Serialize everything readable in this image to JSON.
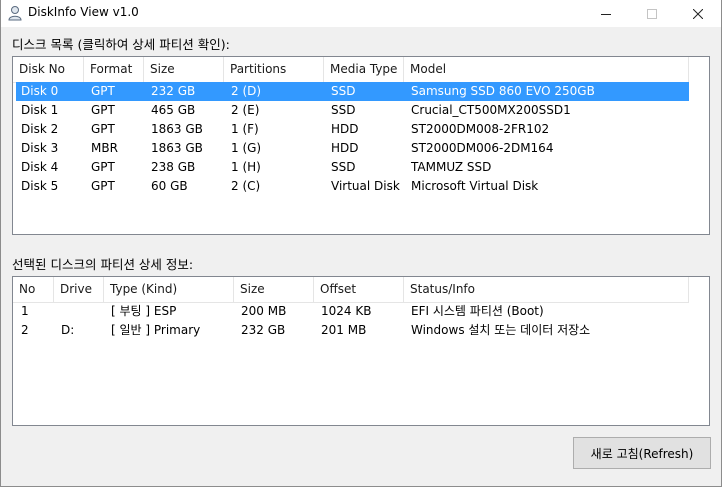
{
  "window": {
    "title": "DiskInfo View v1.0"
  },
  "titlebar_buttons": {
    "minimize": "—",
    "maximize": "☐",
    "close": "✕"
  },
  "disk_section": {
    "label": "디스크 목록 (클릭하여 상세 파티션 확인):"
  },
  "disk_list": {
    "columns": [
      "Disk No",
      "Format",
      "Size",
      "Partitions",
      "Media Type",
      "Model"
    ],
    "rows": [
      [
        "Disk 0",
        "GPT",
        "232 GB",
        "2 (D)",
        "SSD",
        "Samsung SSD 860 EVO 250GB"
      ],
      [
        "Disk 1",
        "GPT",
        "465 GB",
        "2 (E)",
        "SSD",
        "Crucial_CT500MX200SSD1"
      ],
      [
        "Disk 2",
        "GPT",
        "1863 GB",
        "1 (F)",
        "HDD",
        "ST2000DM008-2FR102"
      ],
      [
        "Disk 3",
        "MBR",
        "1863 GB",
        "1 (G)",
        "HDD",
        "ST2000DM006-2DM164"
      ],
      [
        "Disk 4",
        "GPT",
        "238 GB",
        "1 (H)",
        "SSD",
        "TAMMUZ SSD"
      ],
      [
        "Disk 5",
        "GPT",
        "60 GB",
        "2 (C)",
        "Virtual Disk",
        "Microsoft Virtual Disk"
      ]
    ],
    "selected_row": "Disk 0"
  },
  "partition_section": {
    "label": "선택된 디스크의 파티션 상세 정보:"
  },
  "partition_list": {
    "columns": [
      "No",
      "Drive",
      "Type (Kind)",
      "Size",
      "Offset",
      "Status/Info"
    ],
    "rows": [
      [
        "1",
        "",
        "[ 부팅 ] ESP",
        "200 MB",
        "1024 KB",
        "EFI 시스템 파티션 (Boot)"
      ],
      [
        "2",
        "D:",
        "[ 일반 ] Primary",
        "232 GB",
        "201 MB",
        "Windows 설치 또는 데이터 저장소"
      ]
    ]
  },
  "refresh_button": {
    "label": "새로 고침(Refresh)"
  },
  "colors": {
    "selection": "#3399ff",
    "window_bg": "#f0f0f0",
    "list_bg": "#ffffff"
  }
}
